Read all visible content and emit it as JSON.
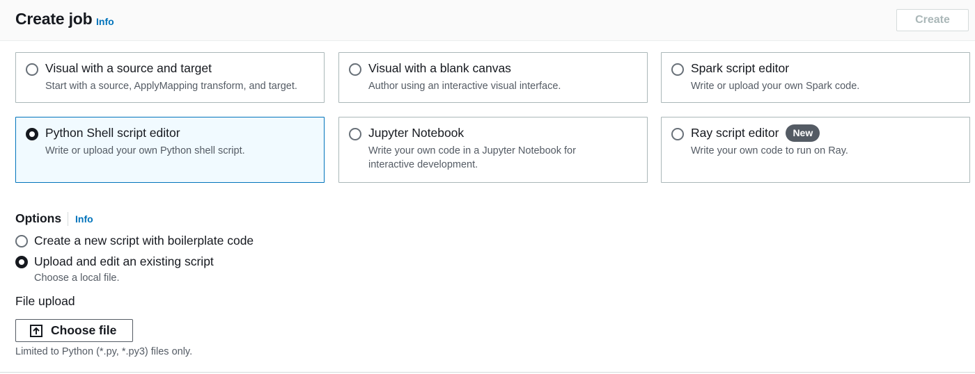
{
  "header": {
    "title": "Create job",
    "info_label": "Info",
    "create_label": "Create"
  },
  "tiles": [
    {
      "title": "Visual with a source and target",
      "desc": "Start with a source, ApplyMapping transform, and target.",
      "selected": false
    },
    {
      "title": "Visual with a blank canvas",
      "desc": "Author using an interactive visual interface.",
      "selected": false
    },
    {
      "title": "Spark script editor",
      "desc": "Write or upload your own Spark code.",
      "selected": false
    },
    {
      "title": "Python Shell script editor",
      "desc": "Write or upload your own Python shell script.",
      "selected": true
    },
    {
      "title": "Jupyter Notebook",
      "desc": "Write your own code in a Jupyter Notebook for interactive development.",
      "selected": false
    },
    {
      "title": "Ray script editor",
      "desc": "Write your own code to run on Ray.",
      "selected": false,
      "badge": "New"
    }
  ],
  "options": {
    "heading": "Options",
    "info_label": "Info",
    "items": [
      {
        "label": "Create a new script with boilerplate code",
        "selected": false
      },
      {
        "label": "Upload and edit an existing script",
        "selected": true,
        "desc": "Choose a local file."
      }
    ]
  },
  "file_upload": {
    "label": "File upload",
    "button_label": "Choose file",
    "constraint": "Limited to Python (*.py, *.py3) files only."
  },
  "icons": {
    "upload": "upload-icon"
  },
  "colors": {
    "link": "#0073bb",
    "selected_bg": "#f1faff",
    "selected_border": "#0073bb",
    "badge_bg": "#545b64"
  }
}
